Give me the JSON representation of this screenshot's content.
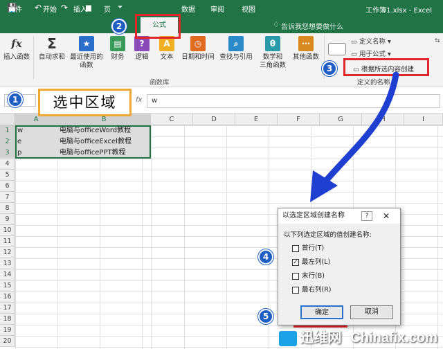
{
  "window": {
    "title": "工作簿1.xlsx - Excel"
  },
  "qat": {
    "save": "💾",
    "undo": "↶",
    "redo": "↷",
    "folder": "▆",
    "more": "⏷"
  },
  "tabs": [
    "文件",
    "开始",
    "插入",
    "页",
    "公式",
    "数据",
    "审阅",
    "视图"
  ],
  "tell_me": "告诉我您想要做什么",
  "ribbon": {
    "insert_function": "插入函数",
    "autosum": "自动求和",
    "recent": [
      "最近使用的",
      "函数"
    ],
    "finance": "财务",
    "logic": "逻辑",
    "text": "文本",
    "datetime": "日期和时间",
    "lookup": "查找与引用",
    "math": [
      "数学和",
      "三角函数"
    ],
    "other": "其他函数",
    "group_label": "函数库",
    "define_name": "定义名称",
    "use_in_formula": "用于公式",
    "create_from_selection": "根据所选内容创建",
    "defined_names_group": "定义的名称"
  },
  "formula_bar": {
    "value": "w"
  },
  "columns": [
    "A",
    "B",
    "C",
    "D",
    "E",
    "F",
    "G",
    "H",
    "I"
  ],
  "rows": [
    "1",
    "2",
    "3",
    "4",
    "5",
    "6",
    "7",
    "8",
    "9",
    "10",
    "11",
    "12",
    "13",
    "14",
    "15",
    "16",
    "17",
    "18",
    "19",
    "20"
  ],
  "cells": {
    "a1": "w",
    "b1": "电脑与officeWord教程",
    "a2": "e",
    "b2": "电脑与officeExcel教程",
    "a3": "p",
    "b3": "电脑与officePPT教程"
  },
  "callout_text": "选中区域",
  "steps": [
    "1",
    "2",
    "3",
    "4",
    "5"
  ],
  "dialog": {
    "title": "以选定区域创建名称",
    "help": "?",
    "close": "✕",
    "prompt": "以下列选定区域的值创建名称:",
    "options": [
      {
        "label": "首行(T)",
        "checked": false
      },
      {
        "label": "最左列(L)",
        "checked": true
      },
      {
        "label": "末行(B)",
        "checked": false
      },
      {
        "label": "最右列(R)",
        "checked": false
      }
    ],
    "ok": "确定",
    "cancel": "取消"
  },
  "watermark": {
    "cn": "迅维网",
    "en": "Chinafix.com"
  },
  "colors": {
    "excel_green": "#217346",
    "step_blue": "#1f5fc4",
    "highlight_red": "#e0262a",
    "arrow_blue": "#1f3fd0"
  }
}
